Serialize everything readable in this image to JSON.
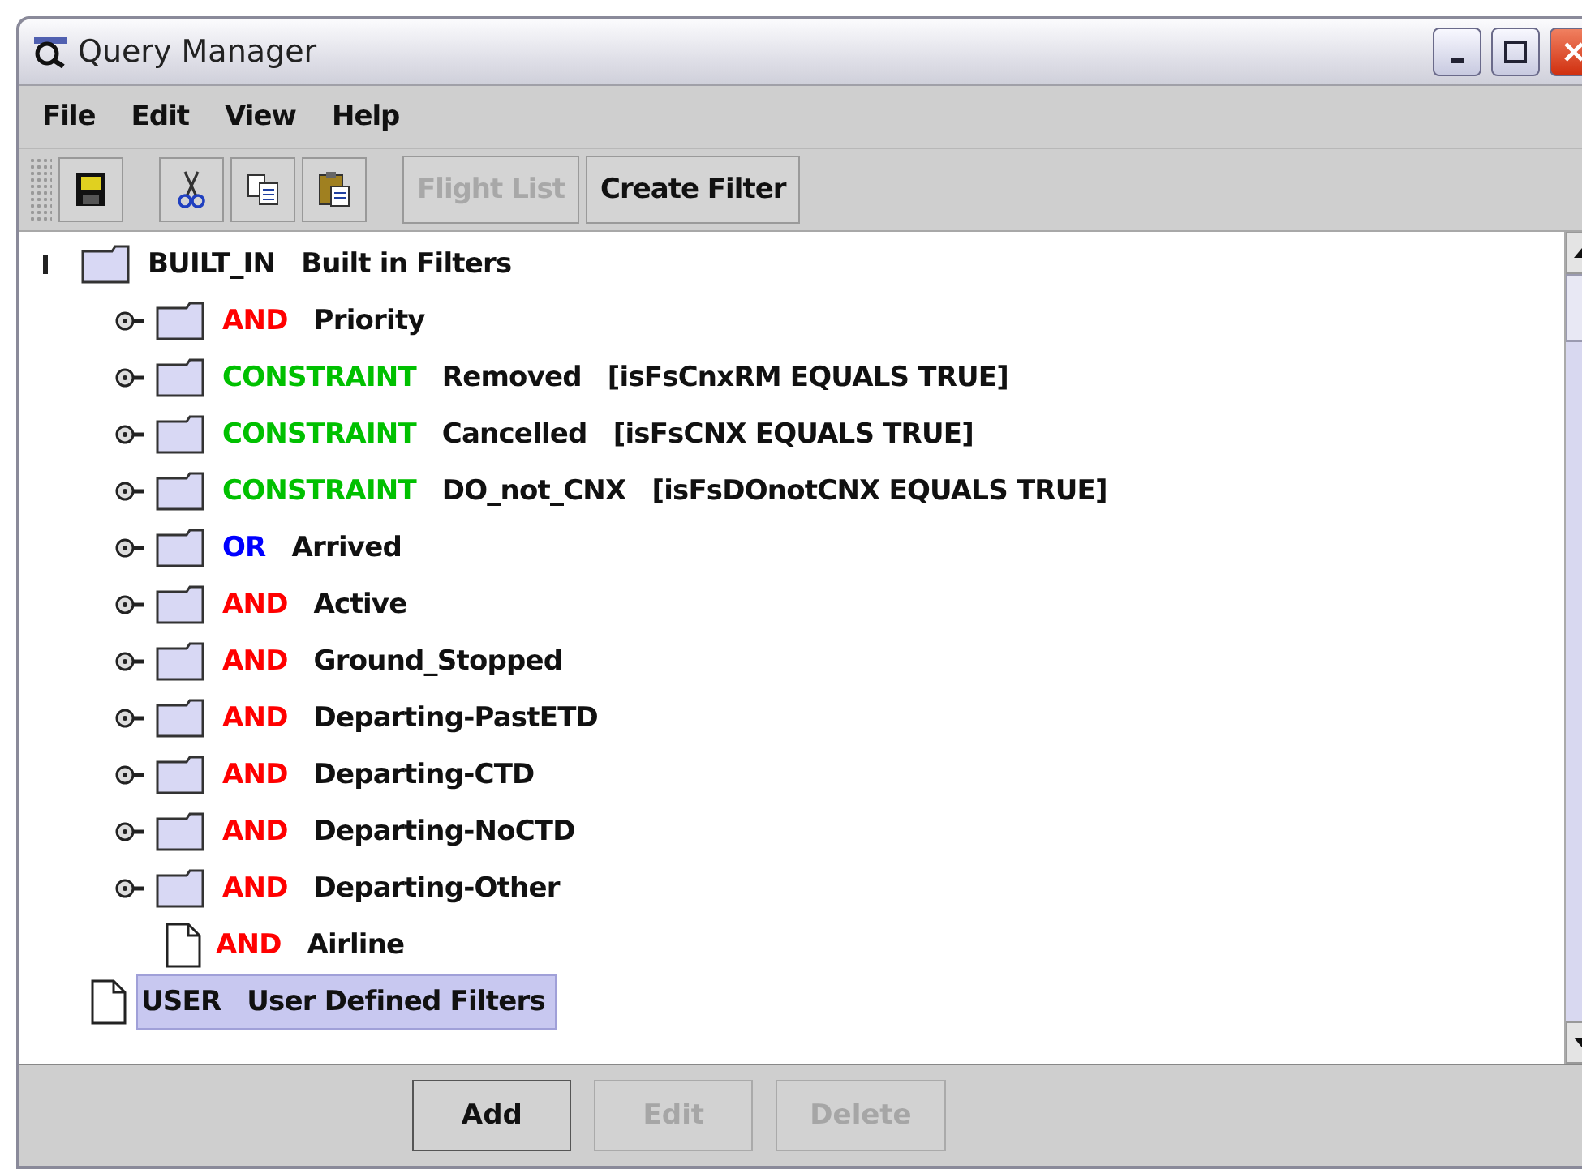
{
  "window": {
    "title": "Query Manager"
  },
  "menu": [
    "File",
    "Edit",
    "View",
    "Help"
  ],
  "toolbar": {
    "icon_buttons": [
      {
        "kind": "save"
      },
      {
        "kind": "cut"
      },
      {
        "kind": "copy"
      },
      {
        "kind": "paste"
      }
    ],
    "text_buttons": [
      {
        "label": "Flight List",
        "disabled": true
      },
      {
        "label": "Create Filter",
        "disabled": false
      }
    ]
  },
  "tree": [
    {
      "operator": "BUILT_IN",
      "name": "Built in Filters",
      "kind": "folder",
      "expanded": true,
      "selected": false,
      "children": [
        {
          "operator": "AND",
          "color": "#ff0000",
          "name": "Priority",
          "kind": "folder",
          "expanded": false,
          "selected": false
        },
        {
          "operator": "CONSTRAINT",
          "color": "#00c000",
          "name": "Removed",
          "condition": "[isFsCnxRM EQUALS TRUE]",
          "kind": "folder",
          "expanded": false,
          "selected": false
        },
        {
          "operator": "CONSTRAINT",
          "color": "#00c000",
          "name": "Cancelled",
          "condition": "[isFsCNX EQUALS TRUE]",
          "kind": "folder",
          "expanded": false,
          "selected": false
        },
        {
          "operator": "CONSTRAINT",
          "color": "#00c000",
          "name": "DO_not_CNX",
          "condition": "[isFsDOnotCNX EQUALS TRUE]",
          "kind": "folder",
          "expanded": false,
          "selected": false
        },
        {
          "operator": "OR",
          "color": "#0000ff",
          "name": "Arrived",
          "kind": "folder",
          "expanded": false,
          "selected": false
        },
        {
          "operator": "AND",
          "color": "#ff0000",
          "name": "Active",
          "kind": "folder",
          "expanded": false,
          "selected": false
        },
        {
          "operator": "AND",
          "color": "#ff0000",
          "name": "Ground_Stopped",
          "kind": "folder",
          "expanded": false,
          "selected": false
        },
        {
          "operator": "AND",
          "color": "#ff0000",
          "name": "Departing-PastETD",
          "kind": "folder",
          "expanded": false,
          "selected": false
        },
        {
          "operator": "AND",
          "color": "#ff0000",
          "name": "Departing-CTD",
          "kind": "folder",
          "expanded": false,
          "selected": false
        },
        {
          "operator": "AND",
          "color": "#ff0000",
          "name": "Departing-NoCTD",
          "kind": "folder",
          "expanded": false,
          "selected": false
        },
        {
          "operator": "AND",
          "color": "#ff0000",
          "name": "Departing-Other",
          "kind": "folder",
          "expanded": false,
          "selected": false
        },
        {
          "operator": "AND",
          "color": "#ff0000",
          "name": "Airline",
          "kind": "leaf",
          "selected": false
        }
      ]
    },
    {
      "operator": "USER",
      "name": "User Defined Filters",
      "kind": "leaf",
      "selected": true
    }
  ],
  "buttons": [
    {
      "label": "Add",
      "disabled": false
    },
    {
      "label": "Edit",
      "disabled": true
    },
    {
      "label": "Delete",
      "disabled": true
    }
  ]
}
